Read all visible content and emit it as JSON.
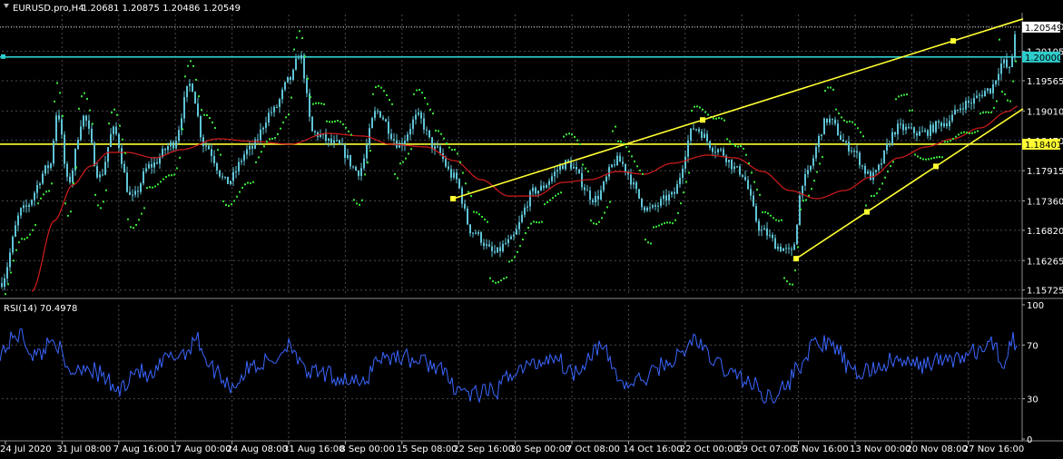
{
  "header": {
    "symbol": "EURUSD.pro,H4",
    "ohlc": "1.20681 1.20875 1.20486 1.20549"
  },
  "rsi_header": {
    "label": "RSI(14) 70.4978"
  },
  "colors": {
    "background": "#000000",
    "grid": "#4a4a4a",
    "candle": "#5fc4d6",
    "ma": "#d21c1c",
    "sar": "#39e639",
    "trendline": "#ffff33",
    "horizontal_cyan": "#2ecccc",
    "horizontal_yellow": "#ffff33",
    "rsi_line": "#3a66ff",
    "axis_text": "#ffffff"
  },
  "chart_data": [
    {
      "type": "line",
      "name": "price",
      "ylim": [
        1.1562,
        1.2078
      ],
      "yticks": [
        "1.20560",
        "1.20105",
        "1.19565",
        "1.19010",
        "1.18470",
        "1.17915",
        "1.17360",
        "1.16820",
        "1.16265",
        "1.15725"
      ],
      "ytick_values": [
        1.2056,
        1.20105,
        1.19565,
        1.1901,
        1.1847,
        1.17915,
        1.1736,
        1.1682,
        1.16265,
        1.15725
      ],
      "xticks": [
        "24 Jul 2020",
        "31 Jul 08:00",
        "7 Aug 16:00",
        "17 Aug 00:00",
        "24 Aug 08:00",
        "31 Aug 16:00",
        "8 Sep 00:00",
        "15 Sep 08:00",
        "22 Sep 16:00",
        "30 Sep 00:00",
        "7 Oct 08:00",
        "14 Oct 16:00",
        "22 Oct 00:00",
        "29 Oct 07:00",
        "5 Nov 16:00",
        "13 Nov 00:00",
        "20 Nov 08:00",
        "27 Nov 16:00"
      ],
      "price_anchors": [
        [
          0,
          1.1585
        ],
        [
          25,
          1.172
        ],
        [
          55,
          1.18
        ],
        [
          63,
          1.19
        ],
        [
          75,
          1.177
        ],
        [
          92,
          1.189
        ],
        [
          110,
          1.178
        ],
        [
          125,
          1.1865
        ],
        [
          145,
          1.174
        ],
        [
          165,
          1.18
        ],
        [
          190,
          1.184
        ],
        [
          210,
          1.195
        ],
        [
          225,
          1.184
        ],
        [
          250,
          1.177
        ],
        [
          275,
          1.183
        ],
        [
          300,
          1.19
        ],
        [
          320,
          1.196
        ],
        [
          330,
          1.2005
        ],
        [
          345,
          1.186
        ],
        [
          370,
          1.184
        ],
        [
          395,
          1.179
        ],
        [
          415,
          1.19
        ],
        [
          440,
          1.184
        ],
        [
          460,
          1.189
        ],
        [
          480,
          1.183
        ],
        [
          500,
          1.178
        ],
        [
          520,
          1.168
        ],
        [
          545,
          1.164
        ],
        [
          560,
          1.166
        ],
        [
          590,
          1.1755
        ],
        [
          625,
          1.1805
        ],
        [
          655,
          1.174
        ],
        [
          680,
          1.181
        ],
        [
          715,
          1.172
        ],
        [
          740,
          1.1745
        ],
        [
          765,
          1.187
        ],
        [
          790,
          1.183
        ],
        [
          815,
          1.179
        ],
        [
          840,
          1.168
        ],
        [
          860,
          1.165
        ],
        [
          872,
          1.164
        ],
        [
          885,
          1.1775
        ],
        [
          912,
          1.1885
        ],
        [
          935,
          1.1835
        ],
        [
          960,
          1.178
        ],
        [
          990,
          1.187
        ],
        [
          1015,
          1.186
        ],
        [
          1040,
          1.188
        ],
        [
          1065,
          1.1915
        ],
        [
          1090,
          1.194
        ],
        [
          1105,
          1.199
        ],
        [
          1112,
          1.1975
        ],
        [
          1120,
          1.206
        ]
      ],
      "ma_anchors": [
        [
          35,
          1.157
        ],
        [
          60,
          1.17
        ],
        [
          80,
          1.1765
        ],
        [
          100,
          1.18
        ],
        [
          120,
          1.1825
        ],
        [
          140,
          1.1825
        ],
        [
          170,
          1.1815
        ],
        [
          200,
          1.183
        ],
        [
          240,
          1.185
        ],
        [
          280,
          1.1845
        ],
        [
          320,
          1.184
        ],
        [
          360,
          1.186
        ],
        [
          400,
          1.1855
        ],
        [
          430,
          1.184
        ],
        [
          470,
          1.1835
        ],
        [
          500,
          1.181
        ],
        [
          530,
          1.1775
        ],
        [
          560,
          1.1745
        ],
        [
          590,
          1.1745
        ],
        [
          620,
          1.177
        ],
        [
          650,
          1.1775
        ],
        [
          680,
          1.179
        ],
        [
          710,
          1.1785
        ],
        [
          740,
          1.1805
        ],
        [
          780,
          1.182
        ],
        [
          810,
          1.1815
        ],
        [
          840,
          1.179
        ],
        [
          870,
          1.1755
        ],
        [
          900,
          1.174
        ],
        [
          930,
          1.1755
        ],
        [
          960,
          1.178
        ],
        [
          990,
          1.1815
        ],
        [
          1020,
          1.1835
        ],
        [
          1050,
          1.185
        ],
        [
          1080,
          1.187
        ],
        [
          1110,
          1.19
        ],
        [
          1122,
          1.191
        ]
      ],
      "trendlines": [
        {
          "x1": 499,
          "y1": 1.174,
          "x2": 1127,
          "y2": 1.207,
          "mid": 774
        },
        {
          "x1": 877,
          "y1": 1.163,
          "x2": 1127,
          "y2": 1.1905,
          "mid": 955,
          "mid2": 1031
        }
      ],
      "hlines": [
        {
          "value": 1.2,
          "label": "1.20000",
          "color": "cyan"
        },
        {
          "value": 1.184,
          "label": "1.18401",
          "color": "yellow"
        }
      ],
      "dotted_hline": {
        "value": 1.20549,
        "label": "1.20549"
      }
    },
    {
      "type": "line",
      "name": "RSI(14)",
      "ylim": [
        0,
        100
      ],
      "yticks": [
        "100",
        "70",
        "30",
        "0"
      ],
      "ytick_values": [
        100,
        70,
        30,
        0
      ],
      "rsi_anchors": [
        [
          0,
          65
        ],
        [
          20,
          78
        ],
        [
          40,
          62
        ],
        [
          60,
          75
        ],
        [
          75,
          50
        ],
        [
          95,
          55
        ],
        [
          110,
          48
        ],
        [
          130,
          36
        ],
        [
          150,
          52
        ],
        [
          165,
          45
        ],
        [
          185,
          60
        ],
        [
          205,
          65
        ],
        [
          215,
          75
        ],
        [
          235,
          52
        ],
        [
          255,
          40
        ],
        [
          280,
          55
        ],
        [
          300,
          58
        ],
        [
          320,
          72
        ],
        [
          335,
          50
        ],
        [
          355,
          48
        ],
        [
          380,
          45
        ],
        [
          400,
          40
        ],
        [
          415,
          60
        ],
        [
          440,
          62
        ],
        [
          460,
          58
        ],
        [
          480,
          55
        ],
        [
          500,
          40
        ],
        [
          520,
          33
        ],
        [
          545,
          35
        ],
        [
          565,
          50
        ],
        [
          585,
          55
        ],
        [
          610,
          62
        ],
        [
          630,
          50
        ],
        [
          660,
          68
        ],
        [
          690,
          40
        ],
        [
          710,
          45
        ],
        [
          730,
          55
        ],
        [
          750,
          62
        ],
        [
          765,
          75
        ],
        [
          785,
          58
        ],
        [
          810,
          48
        ],
        [
          830,
          40
        ],
        [
          845,
          32
        ],
        [
          865,
          38
        ],
        [
          880,
          55
        ],
        [
          900,
          72
        ],
        [
          920,
          68
        ],
        [
          940,
          48
        ],
        [
          960,
          52
        ],
        [
          985,
          58
        ],
        [
          1010,
          55
        ],
        [
          1035,
          58
        ],
        [
          1055,
          60
        ],
        [
          1075,
          65
        ],
        [
          1095,
          70
        ],
        [
          1105,
          55
        ],
        [
          1115,
          75
        ],
        [
          1120,
          70
        ]
      ],
      "current": 70.4978
    }
  ]
}
